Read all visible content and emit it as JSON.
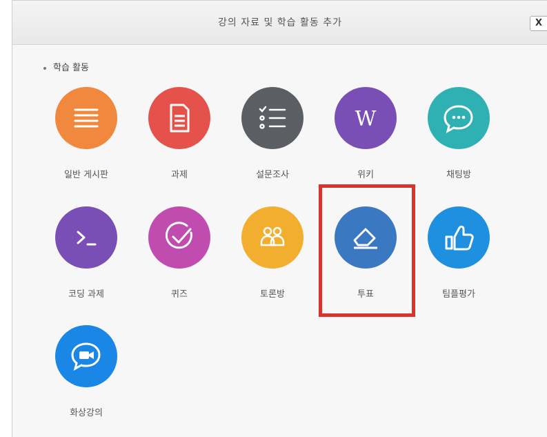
{
  "dialog": {
    "title": "강의 자료 및 학습 활동 추가",
    "close_label": "X",
    "section_label": "학습 활동"
  },
  "activities": [
    {
      "label": "일반 게시판",
      "icon": "list-icon",
      "color": "#f0883e"
    },
    {
      "label": "과제",
      "icon": "document-icon",
      "color": "#e4524b"
    },
    {
      "label": "설문조사",
      "icon": "checklist-icon",
      "color": "#5b5e63"
    },
    {
      "label": "위키",
      "icon": "wiki-w-icon",
      "color": "#7a4fb5"
    },
    {
      "label": "채팅방",
      "icon": "chat-bubble-icon",
      "color": "#2fb1b4"
    },
    {
      "label": "코딩 과제",
      "icon": "terminal-icon",
      "color": "#7a4fb5"
    },
    {
      "label": "퀴즈",
      "icon": "check-circle-icon",
      "color": "#bf4cae"
    },
    {
      "label": "토론방",
      "icon": "people-icon",
      "color": "#f2ae2e"
    },
    {
      "label": "투표",
      "icon": "eraser-icon",
      "color": "#3b78c2"
    },
    {
      "label": "팀플평가",
      "icon": "thumbs-up-icon",
      "color": "#1f8fe0"
    },
    {
      "label": "화상강의",
      "icon": "video-chat-icon",
      "color": "#1a86e6"
    }
  ],
  "highlight_color": "#d9332e"
}
